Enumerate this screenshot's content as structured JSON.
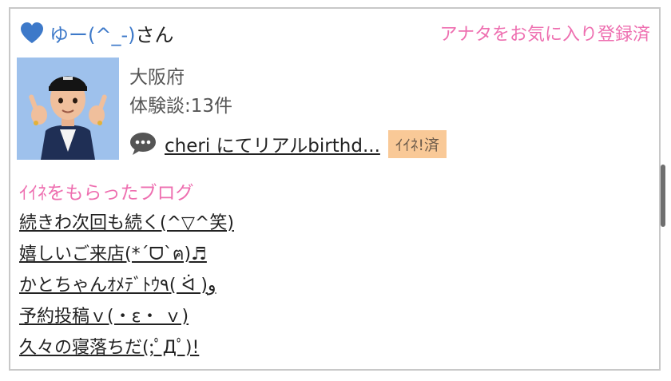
{
  "user": {
    "name": "ゆー(^_-)",
    "suffix": "さん",
    "heart_color": "#3d79c9"
  },
  "favorite_status": "アナタをお気に入り登録済",
  "profile": {
    "region": "大阪府",
    "review_count": "体験談:13件"
  },
  "latest_review": {
    "icon": "chat-bubble-icon",
    "title": "cheri にてリアルbirthd...",
    "like_badge": "ｲｲﾈ!済"
  },
  "liked_blogs": {
    "title": "ｲｲﾈをもらったブログ",
    "items": [
      "続きわ次回も続く(^▽^笑)",
      "嬉しいご来店(*´ᗜ`ฅ)♬",
      "かとちゃんｵﾒﾃﾞﾄｳ٩( ᐛ )و",
      "予約投稿ｖ(・ε・ ｖ)",
      "久々の寝落ちだ(;ﾟДﾟ)!"
    ]
  },
  "colors": {
    "accent_pink": "#ee6fb0",
    "link_blue": "#3d79c9",
    "badge_bg": "#f9c997",
    "border": "#c8c8c8"
  }
}
